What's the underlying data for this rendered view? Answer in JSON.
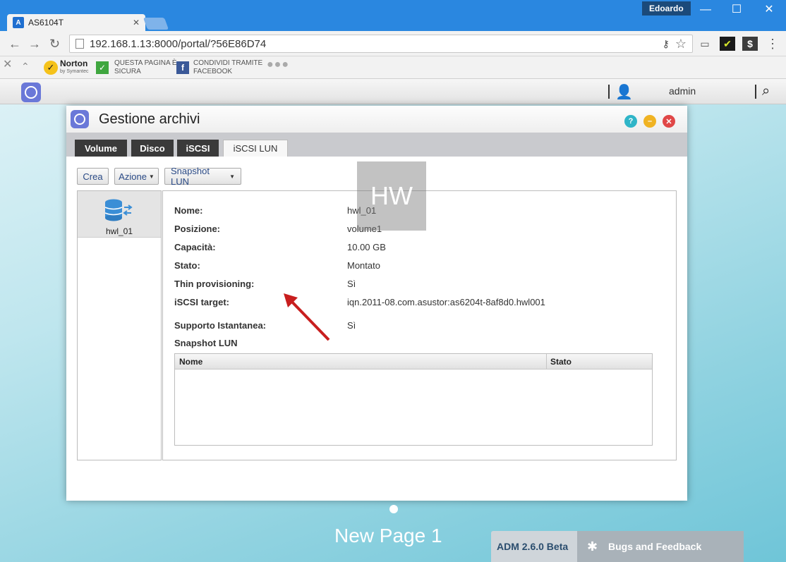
{
  "browser": {
    "tab_title": "AS6104T",
    "profile_name": "Edoardo",
    "url": "192.168.1.13:8000/portal/?56E86D74",
    "extensions": {
      "norton_label": "Norton",
      "norton_sub": "by Symantec",
      "safe_line1": "QUESTA PAGINA È",
      "safe_line2": "SICURA",
      "share_line1": "CONDIVIDI TRAMITE",
      "share_line2": "FACEBOOK"
    }
  },
  "taskbar": {
    "user": "admin"
  },
  "app": {
    "title": "Gestione archivi",
    "tabs": [
      {
        "label": "Volume"
      },
      {
        "label": "Disco"
      },
      {
        "label": "iSCSI"
      },
      {
        "label": "iSCSI LUN"
      }
    ],
    "toolbar": {
      "create": "Crea",
      "action": "Azione",
      "snapshot": "Snapshot LUN"
    },
    "lun_list": [
      {
        "name": "hwl_01"
      }
    ],
    "details": [
      {
        "key": "Nome:",
        "value": "hwl_01"
      },
      {
        "key": "Posizione:",
        "value": "volume1"
      },
      {
        "key": "Capacità:",
        "value": "10.00 GB"
      },
      {
        "key": "Stato:",
        "value": "Montato"
      },
      {
        "key": "Thin provisioning:",
        "value": "Sì"
      },
      {
        "key": "iSCSI target:",
        "value": "iqn.2011-08.com.asustor:as6204t-8af8d0.hwl001"
      },
      {
        "key": "Supporto Istantanea:",
        "value": "Sì"
      }
    ],
    "snapshot_section": "Snapshot LUN",
    "grid_columns": [
      "Nome",
      "Stato"
    ]
  },
  "desktop": {
    "page_title": "New Page 1",
    "version": "ADM 2.6.0 Beta",
    "bugs_label": "Bugs and Feedback"
  },
  "colors": {
    "chrome_blue": "#2a87e0",
    "tab_dark": "#3a3a3a",
    "button_text": "#2a4a86"
  }
}
